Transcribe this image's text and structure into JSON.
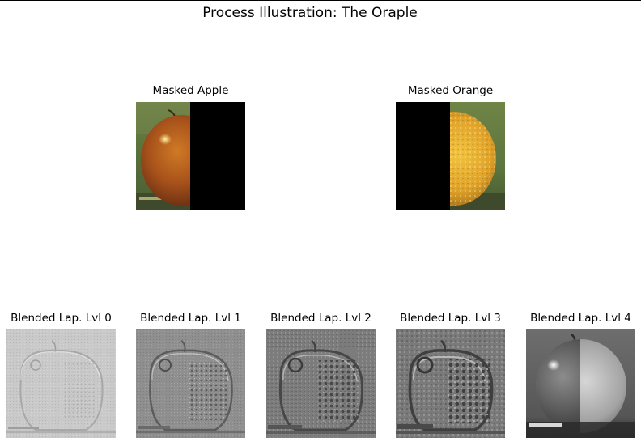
{
  "figure": {
    "title": "Process Illustration: The Oraple"
  },
  "masked": [
    {
      "title": "Masked Apple"
    },
    {
      "title": "Masked Orange"
    }
  ],
  "blended": [
    {
      "title": "Blended Lap. Lvl 0"
    },
    {
      "title": "Blended Lap. Lvl 1"
    },
    {
      "title": "Blended Lap. Lvl 2"
    },
    {
      "title": "Blended Lap. Lvl 3"
    },
    {
      "title": "Blended Lap. Lvl 4"
    }
  ],
  "colors": {
    "background": "#ffffff",
    "mask": "#000000",
    "apple": "#a8521b",
    "orange": "#e0a32a",
    "foliage": "#5f7a3c"
  }
}
